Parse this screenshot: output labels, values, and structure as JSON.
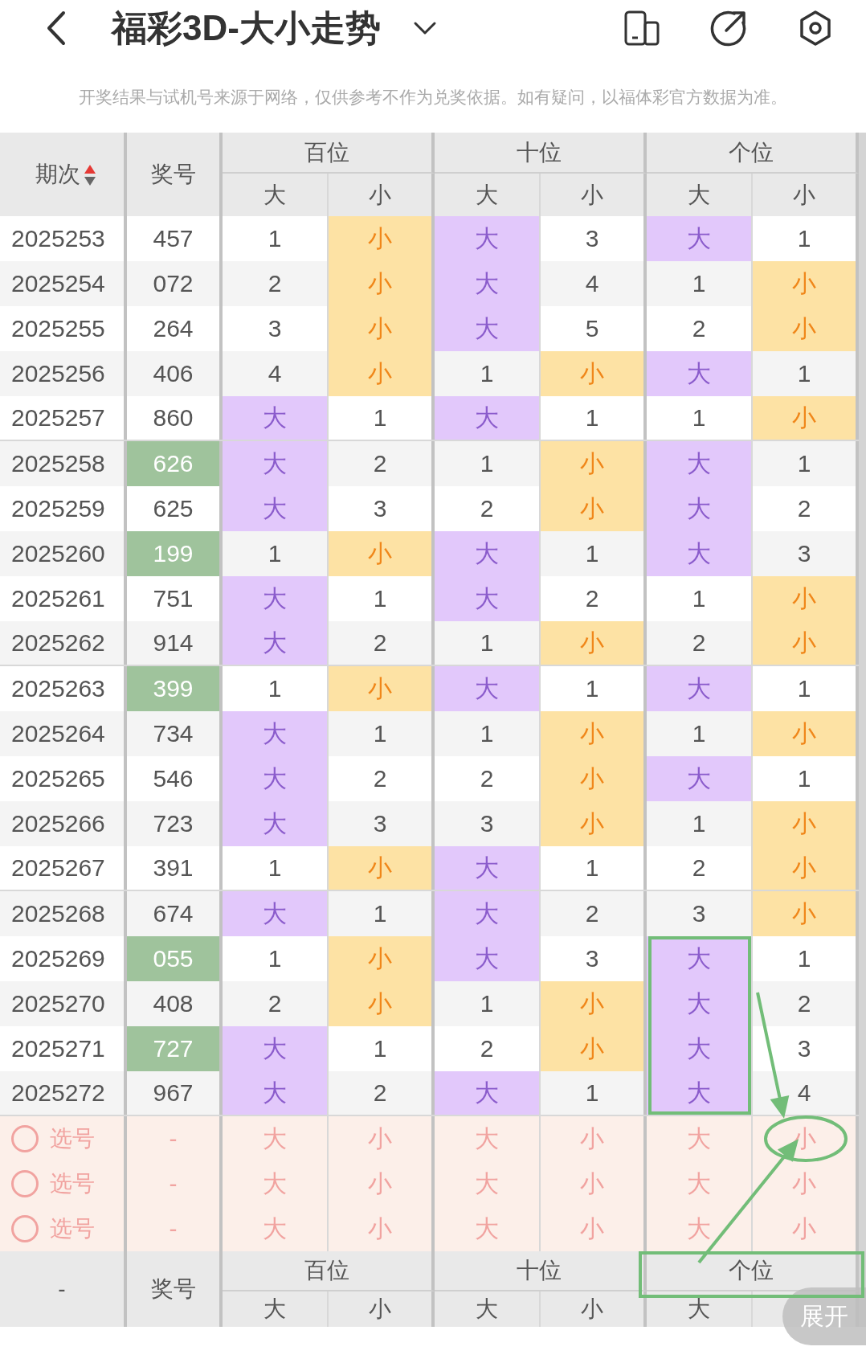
{
  "nav": {
    "title": "福彩3D-大小走势"
  },
  "notice": "开奖结果与试机号来源于网络，仅供参考不作为兑奖依据。如有疑问，以福体彩官方数据为准。",
  "table": {
    "header": {
      "period": "期次",
      "sort_ascending": true,
      "number": "奖号",
      "groups": [
        {
          "label": "百位",
          "sub": [
            "大",
            "小"
          ]
        },
        {
          "label": "十位",
          "sub": [
            "大",
            "小"
          ]
        },
        {
          "label": "个位",
          "sub": [
            "大",
            "小"
          ]
        }
      ]
    },
    "rows": [
      {
        "period": "2025253",
        "number": "457",
        "number_highlighted": false,
        "positions": [
          {
            "big": "1",
            "small": "小",
            "big_hit": false
          },
          {
            "big": "大",
            "small": "3",
            "big_hit": true
          },
          {
            "big": "大",
            "small": "1",
            "big_hit": true
          }
        ]
      },
      {
        "period": "2025254",
        "number": "072",
        "number_highlighted": false,
        "positions": [
          {
            "big": "2",
            "small": "小",
            "big_hit": false
          },
          {
            "big": "大",
            "small": "4",
            "big_hit": true
          },
          {
            "big": "1",
            "small": "小",
            "big_hit": false
          }
        ]
      },
      {
        "period": "2025255",
        "number": "264",
        "number_highlighted": false,
        "positions": [
          {
            "big": "3",
            "small": "小",
            "big_hit": false
          },
          {
            "big": "大",
            "small": "5",
            "big_hit": true
          },
          {
            "big": "2",
            "small": "小",
            "big_hit": false
          }
        ]
      },
      {
        "period": "2025256",
        "number": "406",
        "number_highlighted": false,
        "positions": [
          {
            "big": "4",
            "small": "小",
            "big_hit": false
          },
          {
            "big": "1",
            "small": "小",
            "big_hit": false
          },
          {
            "big": "大",
            "small": "1",
            "big_hit": true
          }
        ]
      },
      {
        "period": "2025257",
        "number": "860",
        "number_highlighted": false,
        "positions": [
          {
            "big": "大",
            "small": "1",
            "big_hit": true
          },
          {
            "big": "大",
            "small": "1",
            "big_hit": true
          },
          {
            "big": "1",
            "small": "小",
            "big_hit": false
          }
        ]
      },
      {
        "period": "2025258",
        "number": "626",
        "number_highlighted": true,
        "positions": [
          {
            "big": "大",
            "small": "2",
            "big_hit": true
          },
          {
            "big": "1",
            "small": "小",
            "big_hit": false
          },
          {
            "big": "大",
            "small": "1",
            "big_hit": true
          }
        ]
      },
      {
        "period": "2025259",
        "number": "625",
        "number_highlighted": false,
        "positions": [
          {
            "big": "大",
            "small": "3",
            "big_hit": true
          },
          {
            "big": "2",
            "small": "小",
            "big_hit": false
          },
          {
            "big": "大",
            "small": "2",
            "big_hit": true
          }
        ]
      },
      {
        "period": "2025260",
        "number": "199",
        "number_highlighted": true,
        "positions": [
          {
            "big": "1",
            "small": "小",
            "big_hit": false
          },
          {
            "big": "大",
            "small": "1",
            "big_hit": true
          },
          {
            "big": "大",
            "small": "3",
            "big_hit": true
          }
        ]
      },
      {
        "period": "2025261",
        "number": "751",
        "number_highlighted": false,
        "positions": [
          {
            "big": "大",
            "small": "1",
            "big_hit": true
          },
          {
            "big": "大",
            "small": "2",
            "big_hit": true
          },
          {
            "big": "1",
            "small": "小",
            "big_hit": false
          }
        ]
      },
      {
        "period": "2025262",
        "number": "914",
        "number_highlighted": false,
        "positions": [
          {
            "big": "大",
            "small": "2",
            "big_hit": true
          },
          {
            "big": "1",
            "small": "小",
            "big_hit": false
          },
          {
            "big": "2",
            "small": "小",
            "big_hit": false
          }
        ]
      },
      {
        "period": "2025263",
        "number": "399",
        "number_highlighted": true,
        "positions": [
          {
            "big": "1",
            "small": "小",
            "big_hit": false
          },
          {
            "big": "大",
            "small": "1",
            "big_hit": true
          },
          {
            "big": "大",
            "small": "1",
            "big_hit": true
          }
        ]
      },
      {
        "period": "2025264",
        "number": "734",
        "number_highlighted": false,
        "positions": [
          {
            "big": "大",
            "small": "1",
            "big_hit": true
          },
          {
            "big": "1",
            "small": "小",
            "big_hit": false
          },
          {
            "big": "1",
            "small": "小",
            "big_hit": false
          }
        ]
      },
      {
        "period": "2025265",
        "number": "546",
        "number_highlighted": false,
        "positions": [
          {
            "big": "大",
            "small": "2",
            "big_hit": true
          },
          {
            "big": "2",
            "small": "小",
            "big_hit": false
          },
          {
            "big": "大",
            "small": "1",
            "big_hit": true
          }
        ]
      },
      {
        "period": "2025266",
        "number": "723",
        "number_highlighted": false,
        "positions": [
          {
            "big": "大",
            "small": "3",
            "big_hit": true
          },
          {
            "big": "3",
            "small": "小",
            "big_hit": false
          },
          {
            "big": "1",
            "small": "小",
            "big_hit": false
          }
        ]
      },
      {
        "period": "2025267",
        "number": "391",
        "number_highlighted": false,
        "positions": [
          {
            "big": "1",
            "small": "小",
            "big_hit": false
          },
          {
            "big": "大",
            "small": "1",
            "big_hit": true
          },
          {
            "big": "2",
            "small": "小",
            "big_hit": false
          }
        ]
      },
      {
        "period": "2025268",
        "number": "674",
        "number_highlighted": false,
        "positions": [
          {
            "big": "大",
            "small": "1",
            "big_hit": true
          },
          {
            "big": "大",
            "small": "2",
            "big_hit": true
          },
          {
            "big": "3",
            "small": "小",
            "big_hit": false
          }
        ]
      },
      {
        "period": "2025269",
        "number": "055",
        "number_highlighted": true,
        "positions": [
          {
            "big": "1",
            "small": "小",
            "big_hit": false
          },
          {
            "big": "大",
            "small": "3",
            "big_hit": true
          },
          {
            "big": "大",
            "small": "1",
            "big_hit": true
          }
        ]
      },
      {
        "period": "2025270",
        "number": "408",
        "number_highlighted": false,
        "positions": [
          {
            "big": "2",
            "small": "小",
            "big_hit": false
          },
          {
            "big": "1",
            "small": "小",
            "big_hit": false
          },
          {
            "big": "大",
            "small": "2",
            "big_hit": true
          }
        ]
      },
      {
        "period": "2025271",
        "number": "727",
        "number_highlighted": true,
        "positions": [
          {
            "big": "大",
            "small": "1",
            "big_hit": true
          },
          {
            "big": "2",
            "small": "小",
            "big_hit": false
          },
          {
            "big": "大",
            "small": "3",
            "big_hit": true
          }
        ]
      },
      {
        "period": "2025272",
        "number": "967",
        "number_highlighted": false,
        "positions": [
          {
            "big": "大",
            "small": "2",
            "big_hit": true
          },
          {
            "big": "大",
            "small": "1",
            "big_hit": true
          },
          {
            "big": "大",
            "small": "4",
            "big_hit": true
          }
        ]
      }
    ],
    "pick_rows": [
      {
        "checked": false,
        "label": "选号",
        "number": "-",
        "options": [
          "大",
          "小",
          "大",
          "小",
          "大",
          "小"
        ]
      },
      {
        "checked": false,
        "label": "选号",
        "number": "-",
        "options": [
          "大",
          "小",
          "大",
          "小",
          "大",
          "小"
        ]
      },
      {
        "checked": false,
        "label": "选号",
        "number": "-",
        "options": [
          "大",
          "小",
          "大",
          "小",
          "大",
          "小"
        ]
      }
    ],
    "footer": {
      "column_1": "-",
      "number": "奖号",
      "groups": [
        {
          "label": "百位",
          "sub": [
            "大",
            "小"
          ]
        },
        {
          "label": "十位",
          "sub": [
            "大",
            "小"
          ]
        },
        {
          "label": "个位",
          "sub": [
            "大"
          ]
        }
      ]
    }
  },
  "expand_button": "展开"
}
